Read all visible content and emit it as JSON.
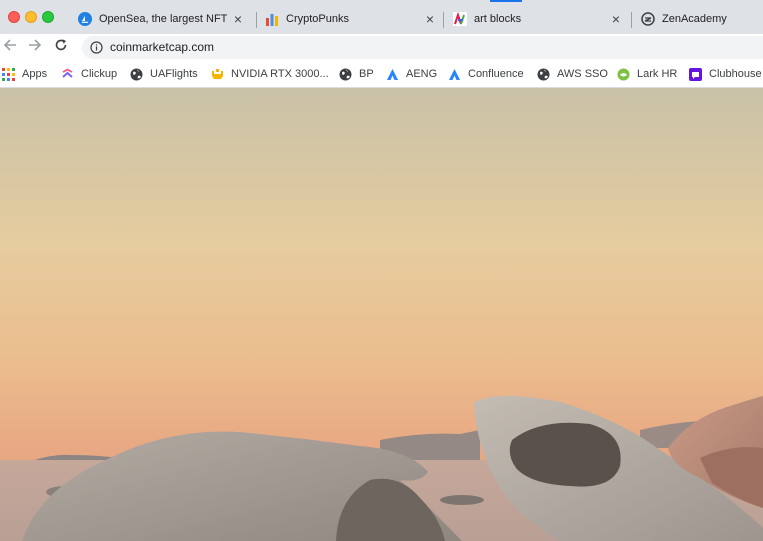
{
  "tabs": [
    {
      "title": "OpenSea, the largest NFT m",
      "favicon": "opensea-icon",
      "close": "×"
    },
    {
      "title": "CryptoPunks",
      "favicon": "cryptopunks-icon",
      "close": "×"
    },
    {
      "title": "art blocks",
      "favicon": "artblocks-icon",
      "close": "×"
    },
    {
      "title": "ZenAcademy",
      "favicon": "zenacademy-icon",
      "close": ""
    }
  ],
  "toolbar": {
    "url": "coinmarketcap.com"
  },
  "bookmarks": [
    {
      "label": "Apps",
      "icon": "apps-grid-icon"
    },
    {
      "label": "Clickup",
      "icon": "clickup-icon"
    },
    {
      "label": "UAFlights",
      "icon": "globe-icon"
    },
    {
      "label": "NVIDIA RTX 3000...",
      "icon": "nvidia-icon"
    },
    {
      "label": "BP",
      "icon": "globe-icon"
    },
    {
      "label": "AENG",
      "icon": "atlassian-icon"
    },
    {
      "label": "Confluence",
      "icon": "atlassian-icon"
    },
    {
      "label": "AWS SSO",
      "icon": "globe-icon"
    },
    {
      "label": "Lark HR",
      "icon": "lark-icon"
    },
    {
      "label": "Clubhouse",
      "icon": "clubhouse-icon"
    }
  ],
  "colors": {
    "tabstrip": "#dee1e6",
    "toolbar": "#ffffff",
    "omnibox": "#f1f3f4",
    "sky_top": "#c9c2a8",
    "sky_mid": "#e9c99a",
    "sky_bottom": "#e6a07e"
  }
}
